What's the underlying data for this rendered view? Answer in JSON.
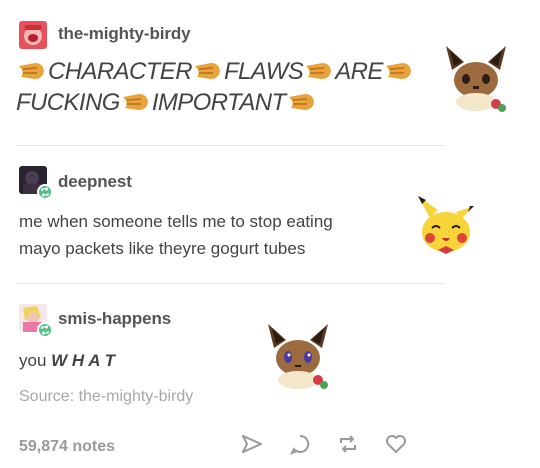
{
  "post1": {
    "username": "the-mighty-birdy",
    "words_line1": [
      "CHARACTER",
      "FLAWS",
      "ARE"
    ],
    "words_line2": [
      "FUCKING",
      "IMPORTANT"
    ],
    "emoji": "clapping-hands-emoji"
  },
  "post2": {
    "username": "deepnest",
    "text_line1": "me when someone tells me to stop eating",
    "text_line2": "mayo packets like theyre gogurt tubes"
  },
  "post3": {
    "username": "smis-happens",
    "text_prefix": "you ",
    "text_emph": "W H A T",
    "source": "Source: the-mighty-birdy",
    "notes": "59,874 notes"
  },
  "actions": {
    "share_icon": "paper-plane-icon",
    "reply_icon": "speech-bubble-icon",
    "reblog_icon": "reblog-arrows-icon",
    "like_icon": "heart-icon"
  },
  "colors": {
    "text": "#444444",
    "muted": "#a7a7a7",
    "reblog_green": "#56bc8a",
    "clap_orange": "#e8a33c"
  }
}
